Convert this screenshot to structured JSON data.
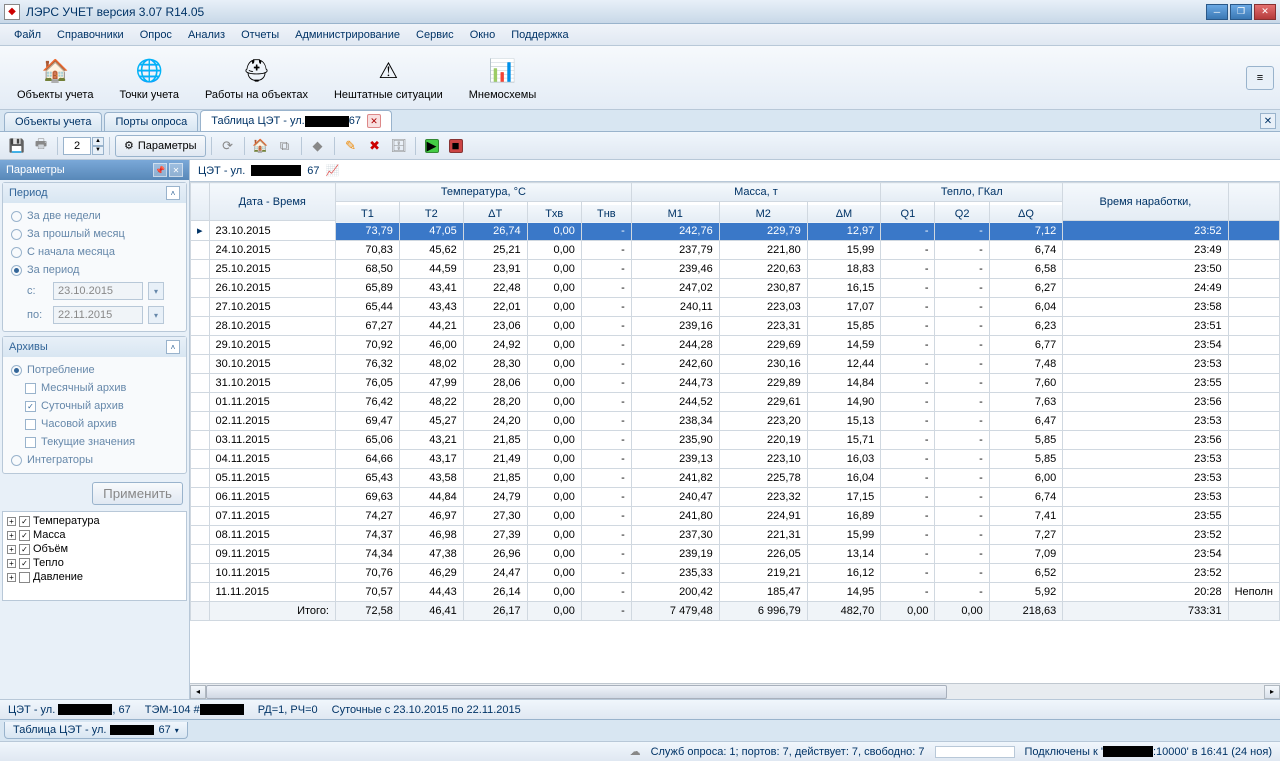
{
  "title": "ЛЭРС УЧЕТ версия 3.07 R14.05",
  "menu": [
    "Файл",
    "Справочники",
    "Опрос",
    "Анализ",
    "Отчеты",
    "Администрирование",
    "Сервис",
    "Окно",
    "Поддержка"
  ],
  "toolbar": [
    {
      "label": "Объекты учета",
      "icon": "🏠"
    },
    {
      "label": "Точки учета",
      "icon": "🌐"
    },
    {
      "label": "Работы на объектах",
      "icon": "⛑"
    },
    {
      "label": "Нештатные ситуации",
      "icon": "⚠"
    },
    {
      "label": "Мнемосхемы",
      "icon": "📊"
    }
  ],
  "tabs": [
    {
      "label": "Объекты учета",
      "active": false,
      "closable": false
    },
    {
      "label": "Порты опроса",
      "active": false,
      "closable": false
    },
    {
      "label": "Таблица ЦЭТ - ул. ███████ 67",
      "active": true,
      "closable": true
    }
  ],
  "spin_value": "2",
  "param_btn": "Параметры",
  "sidebar": {
    "title": "Параметры",
    "period": {
      "title": "Период",
      "items": [
        {
          "label": "За две недели",
          "sel": false
        },
        {
          "label": "За прошлый месяц",
          "sel": false
        },
        {
          "label": "С начала месяца",
          "sel": false
        },
        {
          "label": "За период",
          "sel": true
        }
      ],
      "from_lbl": "с:",
      "from": "23.10.2015",
      "to_lbl": "по:",
      "to": "22.11.2015"
    },
    "archives": {
      "title": "Архивы",
      "consumption": "Потребление",
      "items": [
        {
          "label": "Месячный архив",
          "chk": false
        },
        {
          "label": "Суточный архив",
          "chk": true
        },
        {
          "label": "Часовой архив",
          "chk": false
        },
        {
          "label": "Текущие значения",
          "chk": false
        }
      ],
      "integrators": "Интеграторы"
    },
    "apply": "Применить",
    "tree": [
      {
        "label": "Температура",
        "chk": true
      },
      {
        "label": "Масса",
        "chk": true
      },
      {
        "label": "Объём",
        "chk": true
      },
      {
        "label": "Тепло",
        "chk": true
      },
      {
        "label": "Давление",
        "chk": false
      }
    ]
  },
  "content_title_pre": "ЦЭТ - ул.",
  "content_title_post": "67",
  "grid": {
    "group_headers": [
      "Дата - Время",
      "Температура, °C",
      "Масса, т",
      "Тепло, ГКал",
      "Время наработки,"
    ],
    "cols": [
      "T1",
      "T2",
      "ΔT",
      "Tхв",
      "Tнв",
      "M1",
      "M2",
      "ΔM",
      "Q1",
      "Q2",
      "ΔQ"
    ],
    "rows": [
      {
        "d": "23.10.2015",
        "t1": "73,79",
        "t2": "47,05",
        "dt": "26,74",
        "thv": "0,00",
        "tnv": "-",
        "m1": "242,76",
        "m2": "229,79",
        "dm": "12,97",
        "q1": "-",
        "q2": "-",
        "dq": "7,12",
        "vr": "23:52",
        "sel": true
      },
      {
        "d": "24.10.2015",
        "t1": "70,83",
        "t2": "45,62",
        "dt": "25,21",
        "thv": "0,00",
        "tnv": "-",
        "m1": "237,79",
        "m2": "221,80",
        "dm": "15,99",
        "q1": "-",
        "q2": "-",
        "dq": "6,74",
        "vr": "23:49"
      },
      {
        "d": "25.10.2015",
        "t1": "68,50",
        "t2": "44,59",
        "dt": "23,91",
        "thv": "0,00",
        "tnv": "-",
        "m1": "239,46",
        "m2": "220,63",
        "dm": "18,83",
        "q1": "-",
        "q2": "-",
        "dq": "6,58",
        "vr": "23:50"
      },
      {
        "d": "26.10.2015",
        "t1": "65,89",
        "t2": "43,41",
        "dt": "22,48",
        "thv": "0,00",
        "tnv": "-",
        "m1": "247,02",
        "m2": "230,87",
        "dm": "16,15",
        "q1": "-",
        "q2": "-",
        "dq": "6,27",
        "vr": "24:49"
      },
      {
        "d": "27.10.2015",
        "t1": "65,44",
        "t2": "43,43",
        "dt": "22,01",
        "thv": "0,00",
        "tnv": "-",
        "m1": "240,11",
        "m2": "223,03",
        "dm": "17,07",
        "q1": "-",
        "q2": "-",
        "dq": "6,04",
        "vr": "23:58"
      },
      {
        "d": "28.10.2015",
        "t1": "67,27",
        "t2": "44,21",
        "dt": "23,06",
        "thv": "0,00",
        "tnv": "-",
        "m1": "239,16",
        "m2": "223,31",
        "dm": "15,85",
        "q1": "-",
        "q2": "-",
        "dq": "6,23",
        "vr": "23:51"
      },
      {
        "d": "29.10.2015",
        "t1": "70,92",
        "t2": "46,00",
        "dt": "24,92",
        "thv": "0,00",
        "tnv": "-",
        "m1": "244,28",
        "m2": "229,69",
        "dm": "14,59",
        "q1": "-",
        "q2": "-",
        "dq": "6,77",
        "vr": "23:54"
      },
      {
        "d": "30.10.2015",
        "t1": "76,32",
        "t2": "48,02",
        "dt": "28,30",
        "thv": "0,00",
        "tnv": "-",
        "m1": "242,60",
        "m2": "230,16",
        "dm": "12,44",
        "q1": "-",
        "q2": "-",
        "dq": "7,48",
        "vr": "23:53"
      },
      {
        "d": "31.10.2015",
        "t1": "76,05",
        "t2": "47,99",
        "dt": "28,06",
        "thv": "0,00",
        "tnv": "-",
        "m1": "244,73",
        "m2": "229,89",
        "dm": "14,84",
        "q1": "-",
        "q2": "-",
        "dq": "7,60",
        "vr": "23:55"
      },
      {
        "d": "01.11.2015",
        "t1": "76,42",
        "t2": "48,22",
        "dt": "28,20",
        "thv": "0,00",
        "tnv": "-",
        "m1": "244,52",
        "m2": "229,61",
        "dm": "14,90",
        "q1": "-",
        "q2": "-",
        "dq": "7,63",
        "vr": "23:56"
      },
      {
        "d": "02.11.2015",
        "t1": "69,47",
        "t2": "45,27",
        "dt": "24,20",
        "thv": "0,00",
        "tnv": "-",
        "m1": "238,34",
        "m2": "223,20",
        "dm": "15,13",
        "q1": "-",
        "q2": "-",
        "dq": "6,47",
        "vr": "23:53"
      },
      {
        "d": "03.11.2015",
        "t1": "65,06",
        "t2": "43,21",
        "dt": "21,85",
        "thv": "0,00",
        "tnv": "-",
        "m1": "235,90",
        "m2": "220,19",
        "dm": "15,71",
        "q1": "-",
        "q2": "-",
        "dq": "5,85",
        "vr": "23:56"
      },
      {
        "d": "04.11.2015",
        "t1": "64,66",
        "t2": "43,17",
        "dt": "21,49",
        "thv": "0,00",
        "tnv": "-",
        "m1": "239,13",
        "m2": "223,10",
        "dm": "16,03",
        "q1": "-",
        "q2": "-",
        "dq": "5,85",
        "vr": "23:53"
      },
      {
        "d": "05.11.2015",
        "t1": "65,43",
        "t2": "43,58",
        "dt": "21,85",
        "thv": "0,00",
        "tnv": "-",
        "m1": "241,82",
        "m2": "225,78",
        "dm": "16,04",
        "q1": "-",
        "q2": "-",
        "dq": "6,00",
        "vr": "23:53"
      },
      {
        "d": "06.11.2015",
        "t1": "69,63",
        "t2": "44,84",
        "dt": "24,79",
        "thv": "0,00",
        "tnv": "-",
        "m1": "240,47",
        "m2": "223,32",
        "dm": "17,15",
        "q1": "-",
        "q2": "-",
        "dq": "6,74",
        "vr": "23:53"
      },
      {
        "d": "07.11.2015",
        "t1": "74,27",
        "t2": "46,97",
        "dt": "27,30",
        "thv": "0,00",
        "tnv": "-",
        "m1": "241,80",
        "m2": "224,91",
        "dm": "16,89",
        "q1": "-",
        "q2": "-",
        "dq": "7,41",
        "vr": "23:55"
      },
      {
        "d": "08.11.2015",
        "t1": "74,37",
        "t2": "46,98",
        "dt": "27,39",
        "thv": "0,00",
        "tnv": "-",
        "m1": "237,30",
        "m2": "221,31",
        "dm": "15,99",
        "q1": "-",
        "q2": "-",
        "dq": "7,27",
        "vr": "23:52"
      },
      {
        "d": "09.11.2015",
        "t1": "74,34",
        "t2": "47,38",
        "dt": "26,96",
        "thv": "0,00",
        "tnv": "-",
        "m1": "239,19",
        "m2": "226,05",
        "dm": "13,14",
        "q1": "-",
        "q2": "-",
        "dq": "7,09",
        "vr": "23:54"
      },
      {
        "d": "10.11.2015",
        "t1": "70,76",
        "t2": "46,29",
        "dt": "24,47",
        "thv": "0,00",
        "tnv": "-",
        "m1": "235,33",
        "m2": "219,21",
        "dm": "16,12",
        "q1": "-",
        "q2": "-",
        "dq": "6,52",
        "vr": "23:52"
      },
      {
        "d": "11.11.2015",
        "t1": "70,57",
        "t2": "44,43",
        "dt": "26,14",
        "thv": "0,00",
        "tnv": "-",
        "m1": "200,42",
        "m2": "185,47",
        "dm": "14,95",
        "q1": "-",
        "q2": "-",
        "dq": "5,92",
        "vr": "20:28",
        "note": "Неполн"
      }
    ],
    "totals": {
      "lbl": "Итого:",
      "t1": "72,58",
      "t2": "46,41",
      "dt": "26,17",
      "thv": "0,00",
      "tnv": "-",
      "m1": "7 479,48",
      "m2": "6 996,79",
      "dm": "482,70",
      "q1": "0,00",
      "q2": "0,00",
      "dq": "218,63",
      "vr": "733:31"
    }
  },
  "info": {
    "pt": "ЦЭТ - ул. ██████, 67",
    "dev": "ТЭМ-104 #██████",
    "rd": "РД=1, РЧ=0",
    "range": "Суточные с 23.10.2015 по 22.11.2015"
  },
  "bottom_tab": "Таблица ЦЭТ - ул. ██████ 67",
  "status": {
    "srv": "Служб опроса: 1; портов: 7, действует: 7, свободно: 7",
    "conn_pre": "Подключены к '",
    "conn_post": ":10000' в 16:41 (24 ноя)"
  }
}
